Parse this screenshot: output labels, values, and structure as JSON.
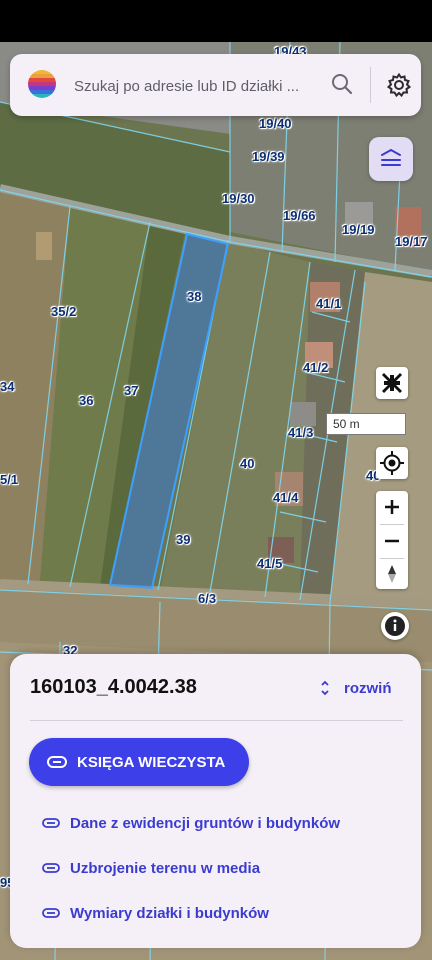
{
  "search": {
    "placeholder": "Szukaj po adresie lub ID działki ..."
  },
  "map": {
    "scale_label": "50 m",
    "parcel_labels": [
      "19/43",
      "19/40",
      "19/39",
      "19/30",
      "19/66",
      "19/19",
      "19/17",
      "35/2",
      "38",
      "41/1",
      "41/2",
      "34",
      "36",
      "37",
      "41/3",
      "40",
      "5/1",
      "41/4",
      "40",
      "39",
      "41/5",
      "6/3",
      "32",
      "95"
    ]
  },
  "parcel_sheet": {
    "parcel_id": "160103_4.0042.38",
    "expand_label": "rozwiń",
    "primary_button": "KSIĘGA WIECZYSTA",
    "links": [
      "Dane z ewidencji gruntów i budynków",
      "Uzbrojenie terenu w media",
      "Wymiary działki i budynków"
    ]
  },
  "colors": {
    "accent": "#3d3fe8",
    "link": "#3b3ccf",
    "selected_parcel_fill": "#2f7cf0",
    "parcel_boundary": "#7fd8f0"
  }
}
